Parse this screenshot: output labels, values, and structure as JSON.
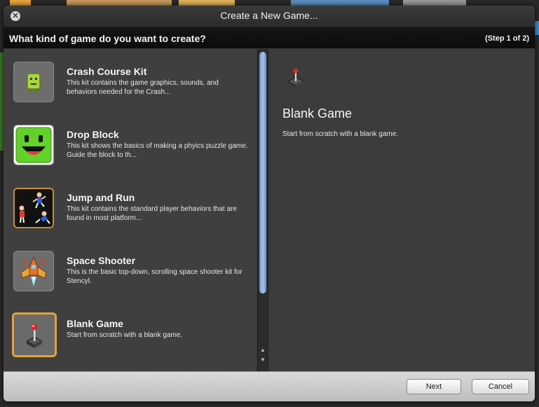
{
  "window": {
    "title": "Create a New Game..."
  },
  "header": {
    "question": "What kind of game do you want to create?",
    "step": "(Step 1 of 2)"
  },
  "kits": [
    {
      "title": "Crash Course Kit",
      "description": "This kit contains the game graphics, sounds, and behaviors needed for the Crash...",
      "icon": "crash-course-icon",
      "selected": false
    },
    {
      "title": "Drop Block",
      "description": "This kit shows the basics of making a phyics puzzle game. Guide the block to th...",
      "icon": "smiley-block-icon",
      "selected": false
    },
    {
      "title": "Jump and Run",
      "description": "This kit contains the standard player behaviors that are found in most platform...",
      "icon": "jump-run-icon",
      "selected": false
    },
    {
      "title": "Space Shooter",
      "description": "This is the basic top-down, scrolling space shooter kit for Stencyl.",
      "icon": "spaceship-icon",
      "selected": false
    },
    {
      "title": "Blank Game",
      "description": "Start from scratch with a blank game.",
      "icon": "joystick-icon",
      "selected": true
    }
  ],
  "detail": {
    "title": "Blank Game",
    "description": "Start from scratch with a blank game.",
    "icon": "joystick-icon"
  },
  "buttons": {
    "next": "Next",
    "cancel": "Cancel"
  },
  "colors": {
    "selection_border": "#e3a338",
    "scroll_thumb": "#a8c3ea",
    "dialog_bg": "#3a3a3a"
  }
}
